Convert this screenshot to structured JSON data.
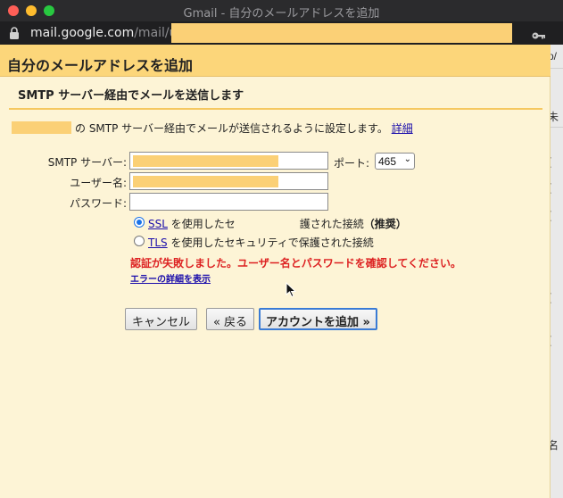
{
  "window": {
    "title": "Gmail - 自分のメールアドレスを追加"
  },
  "address_bar": {
    "host": "mail.google.com",
    "path": "/mail/u/",
    "key_icon": "key-icon",
    "lock_icon": "lock-icon"
  },
  "background": {
    "fragments": [
      "p/",
      "未",
      "(",
      "(",
      "(",
      "(",
      "(",
      "名"
    ]
  },
  "dialog": {
    "title": "自分のメールアドレスを追加",
    "section_title": "SMTP サーバー経由でメールを送信します",
    "description": "の SMTP サーバー経由でメールが送信されるように設定します。",
    "details_link": "詳細",
    "form": {
      "smtp_server_label": "SMTP サーバー:",
      "port_label": "ポート:",
      "port_value": "465",
      "username_label": "ユーザー名:",
      "password_label": "パスワード:"
    },
    "options": {
      "ssl_link": "SSL",
      "ssl_text_a": "を使用したセ",
      "ssl_text_b": "護された接続",
      "ssl_recommended": "（推奨）",
      "tls_link": "TLS",
      "tls_text": "を使用したセキュリティで保護された接続",
      "selected": "SSL"
    },
    "error_message": "認証が失敗しました。ユーザー名とパスワードを確認してください。",
    "error_details_link": "エラーの詳細を表示",
    "buttons": {
      "cancel": "キャンセル",
      "back": "« 戻る",
      "add_account": "アカウントを追加 »"
    }
  },
  "colors": {
    "header_bg": "#fcd67a",
    "dialog_bg": "#fdf4d6",
    "error": "#dd2222",
    "link": "#1a0dab",
    "redaction": "#fbd076"
  }
}
